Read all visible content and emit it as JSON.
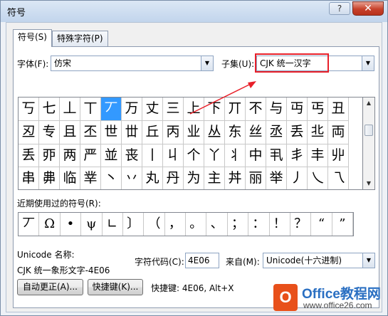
{
  "window": {
    "title": "符号",
    "help_label": "?",
    "close_label": "✕"
  },
  "tabs": [
    {
      "label": "符号(S)",
      "active": true
    },
    {
      "label": "特殊字符(P)",
      "active": false
    }
  ],
  "font": {
    "label": "字体(F):",
    "value": "仿宋"
  },
  "subset": {
    "label": "子集(U):",
    "value": "CJK 统一汉字"
  },
  "symbol_grid": [
    [
      "丂",
      "七",
      "丄",
      "丅",
      "丆",
      "万",
      "丈",
      "三",
      "上",
      "下",
      "丌",
      "不",
      "与",
      "丏",
      "丐",
      "丑"
    ],
    [
      "丒",
      "专",
      "且",
      "丕",
      "世",
      "丗",
      "丘",
      "丙",
      "业",
      "丛",
      "东",
      "丝",
      "丞",
      "丢",
      "丠",
      "両"
    ],
    [
      "丢",
      "丣",
      "两",
      "严",
      "並",
      "丧",
      "丨",
      "丩",
      "个",
      "丫",
      "丬",
      "中",
      "丮",
      "丯",
      "丰",
      "丱"
    ],
    [
      "串",
      "丳",
      "临",
      "丵",
      "丶",
      "丷",
      "丸",
      "丹",
      "为",
      "主",
      "丼",
      "丽",
      "举",
      "丿",
      "乀",
      "乁"
    ]
  ],
  "selected_symbol": "丆",
  "recent": {
    "label": "近期使用过的符号(R):",
    "symbols": [
      "丆",
      "Ω",
      "•",
      "ψ",
      "∟",
      "〕",
      "（",
      "，",
      "。",
      "、",
      "；",
      "：",
      "！",
      "？",
      "“",
      "”"
    ]
  },
  "unicode_name": {
    "label": "Unicode 名称:",
    "value": "CJK 统一象形文字-4E06"
  },
  "char_code": {
    "label": "字符代码(C):",
    "value": "4E06"
  },
  "from": {
    "label": "来自(M):",
    "value": "Unicode(十六进制)"
  },
  "buttons": {
    "autocorrect": "自动更正(A)...",
    "shortcut_key": "快捷键(K)...",
    "shortcut_text": "快捷键: 4E06, Alt+X"
  },
  "watermark": {
    "logo_letter": "O",
    "brand": "Office教程网",
    "url": "www.office26.com"
  },
  "colors": {
    "selection": "#3399ff",
    "highlight": "#e8202a",
    "brand": "#2a6fc2"
  }
}
